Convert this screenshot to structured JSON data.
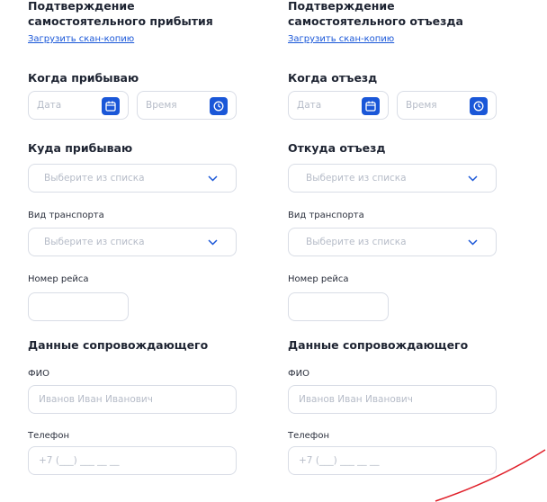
{
  "arrival": {
    "confirm_title": "Подтверждение самостоятельного прибытия",
    "upload_link": "Загрузить скан-копию",
    "when_title": "Когда прибываю",
    "date_placeholder": "Дата",
    "time_placeholder": "Время",
    "where_title": "Куда прибываю",
    "where_placeholder": "Выберите из списка",
    "transport_label": "Вид транспорта",
    "transport_placeholder": "Выберите из списка",
    "flight_label": "Номер рейса",
    "escort_title": "Данные сопровождающего",
    "fio_label": "ФИО",
    "fio_placeholder": "Иванов Иван Иванович",
    "phone_label": "Телефон",
    "phone_placeholder": "+7 (___) ___ __ __"
  },
  "departure": {
    "confirm_title": "Подтверждение самостоятельного отъезда",
    "upload_link": "Загрузить скан-копию",
    "when_title": "Когда отъезд",
    "date_placeholder": "Дата",
    "time_placeholder": "Время",
    "where_title": "Откуда отъезд",
    "where_placeholder": "Выберите из списка",
    "transport_label": "Вид транспорта",
    "transport_placeholder": "Выберите из списка",
    "flight_label": "Номер рейса",
    "escort_title": "Данные сопровождающего",
    "fio_label": "ФИО",
    "fio_placeholder": "Иванов Иван Иванович",
    "phone_label": "Телефон",
    "phone_placeholder": "+7 (___) ___ __ __"
  },
  "colors": {
    "accent": "#1a57d8",
    "annotation": "#e0202a",
    "border": "#d9dde6",
    "placeholder": "#b6bcc8"
  }
}
